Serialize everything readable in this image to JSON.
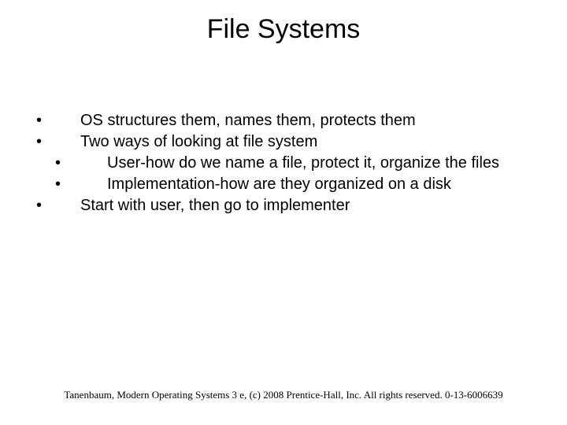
{
  "title": "File Systems",
  "bullets": {
    "item1": "OS structures them, names them, protects them",
    "item2": "Two ways of looking at file system",
    "item2a": "User-how do we name a file, protect it, organize the files",
    "item2b": "Implementation-how are they organized on a disk",
    "item3": "Start with user, then go to implementer"
  },
  "glyphs": {
    "bullet": "•"
  },
  "footer": "Tanenbaum, Modern Operating Systems 3 e, (c) 2008 Prentice-Hall, Inc. All rights reserved. 0-13-6006639"
}
